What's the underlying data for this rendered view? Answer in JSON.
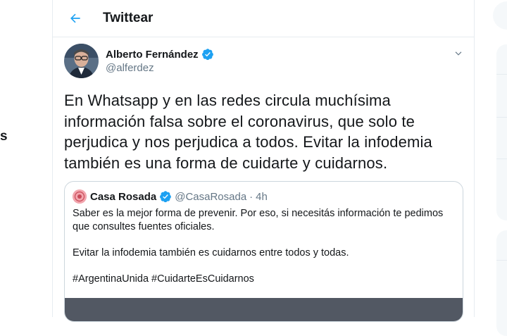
{
  "left_nav": {
    "partial_label": "s"
  },
  "header": {
    "title": "Twittear",
    "back_icon": "arrow-left-icon",
    "accent_color": "#1da1f2"
  },
  "tweet": {
    "author_name": "Alberto Fernández",
    "author_handle": "@alferdez",
    "verified": true,
    "text": "En Whatsapp y en las redes circula muchísima información falsa sobre el coronavirus, que solo te perjudica y nos perjudica a todos. Evitar la infodemia también es una forma de cuidarte y cuidarnos."
  },
  "quoted_tweet": {
    "author_name": "Casa Rosada",
    "author_handle": "@CasaRosada",
    "separator": "·",
    "time": "4h",
    "verified": true,
    "paragraphs": [
      "Saber es la mejor forma de prevenir. Por eso, si necesitás información te pedimos que consultes fuentes oficiales.",
      "Evitar la infodemia también es cuidarnos entre todos y todas.",
      "#ArgentinaUnida #CuidarteEsCuidarnos"
    ]
  }
}
